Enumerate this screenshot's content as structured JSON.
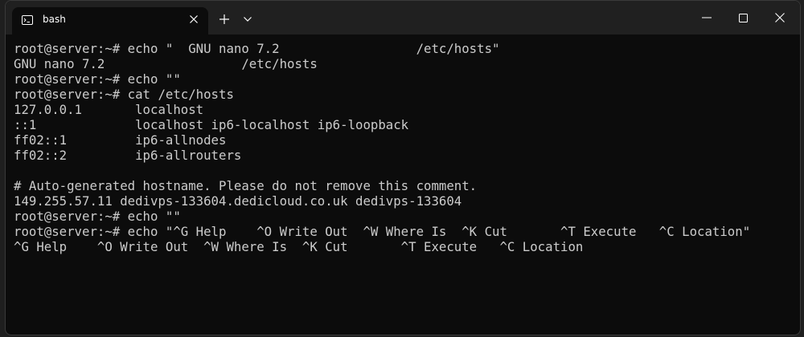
{
  "window": {
    "tab_title": "bash",
    "tab_icon": "terminal-icon",
    "icons": {
      "close_tab": "close-icon",
      "new_tab": "plus-icon",
      "dropdown": "chevron-down-icon",
      "minimize": "minimize-icon",
      "maximize": "maximize-icon",
      "close_window": "close-icon"
    }
  },
  "colors": {
    "terminal_bg": "#0c0c0c",
    "terminal_fg": "#cccccc",
    "titlebar_bg": "#202020"
  },
  "terminal": {
    "lines": [
      "root@server:~# echo \"  GNU nano 7.2                  /etc/hosts\"",
      "GNU nano 7.2                  /etc/hosts",
      "root@server:~# echo \"\"",
      "root@server:~# cat /etc/hosts",
      "127.0.0.1       localhost",
      "::1             localhost ip6-localhost ip6-loopback",
      "ff02::1         ip6-allnodes",
      "ff02::2         ip6-allrouters",
      "",
      "# Auto-generated hostname. Please do not remove this comment.",
      "149.255.57.11 dedivps-133604.dedicloud.co.uk dedivps-133604",
      "root@server:~# echo \"\"",
      "root@server:~# echo \"^G Help    ^O Write Out  ^W Where Is  ^K Cut       ^T Execute   ^C Location\"",
      "^G Help    ^O Write Out  ^W Where Is  ^K Cut       ^T Execute   ^C Location"
    ]
  }
}
